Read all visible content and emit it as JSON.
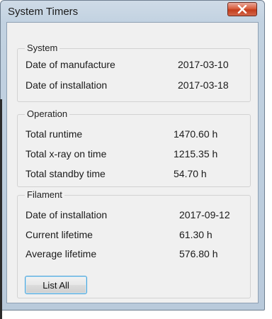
{
  "window": {
    "title": "System Timers"
  },
  "groups": {
    "system": {
      "title": "System",
      "rows": [
        {
          "label": "Date of manufacture",
          "value": "2017-03-10"
        },
        {
          "label": "Date of installation",
          "value": "2017-03-18"
        }
      ]
    },
    "operation": {
      "title": "Operation",
      "rows": [
        {
          "label": "Total runtime",
          "value": "1470.60 h"
        },
        {
          "label": "Total x-ray on time",
          "value": "1215.35 h"
        },
        {
          "label": "Total standby time",
          "value": "54.70 h"
        }
      ]
    },
    "filament": {
      "title": "Filament",
      "rows": [
        {
          "label": "Date of installation",
          "value": "2017-09-12"
        },
        {
          "label": "Current lifetime",
          "value": "61.30 h"
        },
        {
          "label": "Average lifetime",
          "value": "576.80 h"
        }
      ]
    }
  },
  "buttons": {
    "list_all": "List All"
  },
  "icons": {
    "close": "close-x-icon"
  },
  "colors": {
    "close_button": "#c94a2b",
    "focus_border": "#4aa3d8"
  }
}
